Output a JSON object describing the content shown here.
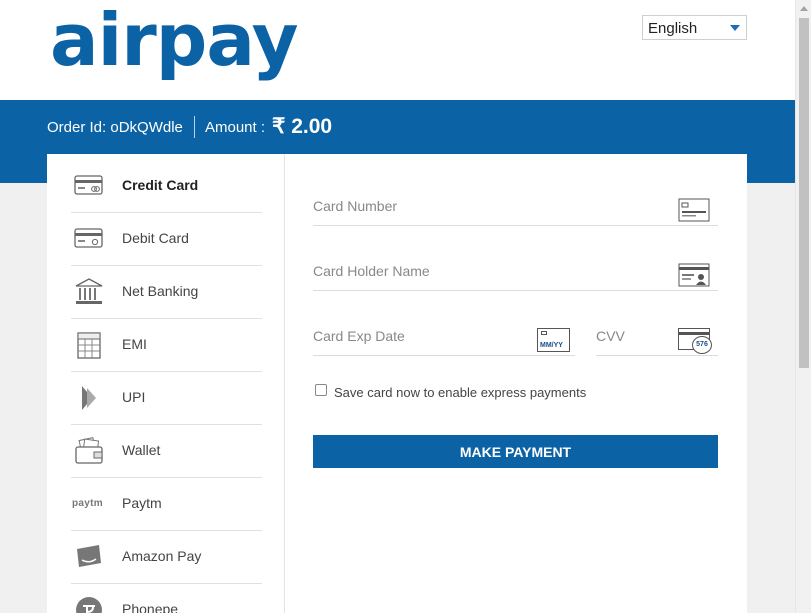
{
  "brand": {
    "logo_text": "airpay"
  },
  "language": {
    "selected": "English"
  },
  "order": {
    "label": "Order Id:",
    "id": "oDkQWdle",
    "amount_label": "Amount :",
    "amount": "₹ 2.00"
  },
  "sidebar": {
    "items": [
      {
        "label": "Credit Card",
        "icon": "credit-card-icon",
        "active": true
      },
      {
        "label": "Debit Card",
        "icon": "debit-card-icon"
      },
      {
        "label": "Net Banking",
        "icon": "bank-icon"
      },
      {
        "label": "EMI",
        "icon": "calculator-icon"
      },
      {
        "label": "UPI",
        "icon": "upi-icon"
      },
      {
        "label": "Wallet",
        "icon": "wallet-icon"
      },
      {
        "label": "Paytm",
        "icon": "paytm-icon",
        "icon_text": "paytm"
      },
      {
        "label": "Amazon Pay",
        "icon": "amazon-pay-icon"
      },
      {
        "label": "Phonepe",
        "icon": "phonepe-icon"
      }
    ]
  },
  "form": {
    "card_number_placeholder": "Card Number",
    "holder_name_placeholder": "Card Holder Name",
    "exp_date_placeholder": "Card Exp Date",
    "exp_icon_text": "MM/YY",
    "cvv_placeholder": "CVV",
    "cvv_icon_text": "576",
    "save_card_label": "Save card now to enable express payments",
    "save_card_checked": false,
    "pay_button_label": "MAKE PAYMENT"
  },
  "colors": {
    "brand_blue": "#0b63a5",
    "text": "#333333",
    "muted": "#888888"
  }
}
